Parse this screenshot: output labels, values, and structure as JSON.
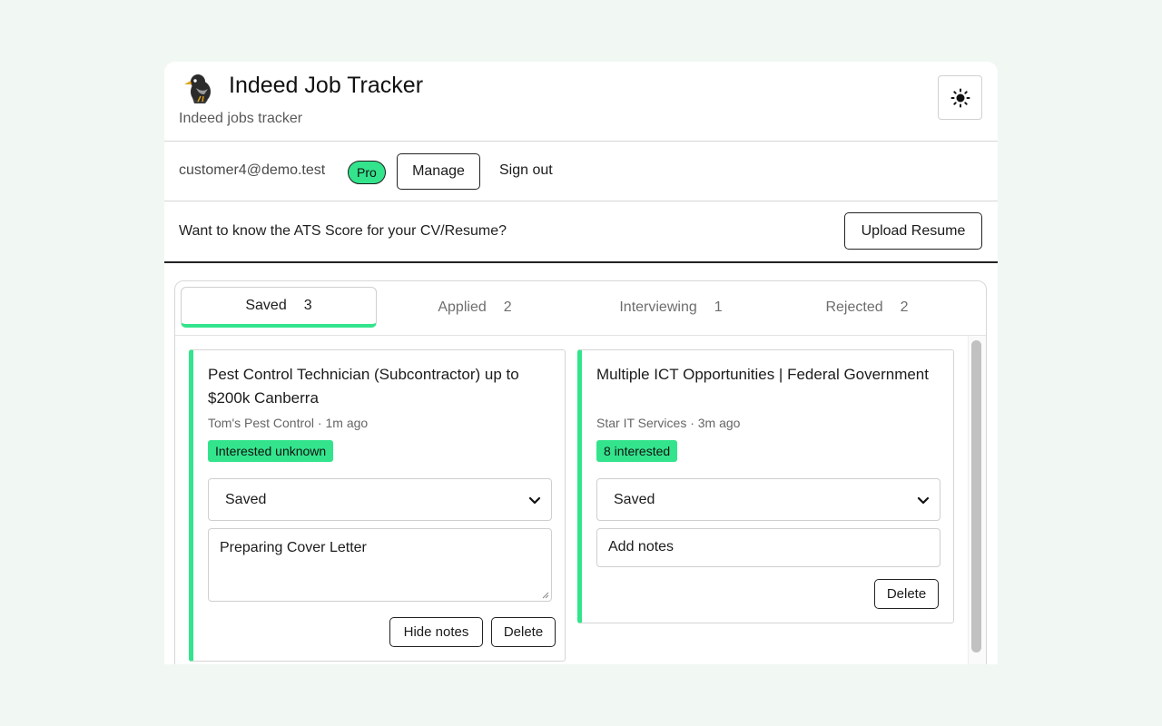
{
  "app": {
    "title": "Indeed Job Tracker",
    "subtitle": "Indeed jobs tracker",
    "logo_icon": "bird-logo-icon",
    "theme_toggle_icon": "sun-icon"
  },
  "account": {
    "email": "customer4@demo.test",
    "plan_badge": "Pro",
    "manage_label": "Manage",
    "signout_label": "Sign out"
  },
  "ats": {
    "prompt": "Want to know the ATS Score for your CV/Resume?",
    "upload_label": "Upload Resume"
  },
  "tabs": [
    {
      "label": "Saved",
      "count": "3",
      "active": true
    },
    {
      "label": "Applied",
      "count": "2",
      "active": false
    },
    {
      "label": "Interviewing",
      "count": "1",
      "active": false
    },
    {
      "label": "Rejected",
      "count": "2",
      "active": false
    }
  ],
  "cards": [
    {
      "title": "Pest Control Technician (Subcontractor) up to $200k Canberra",
      "meta": "Tom's Pest Control · 1m ago",
      "badge": "Interested unknown",
      "status": "Saved",
      "notes_value": "Preparing Cover Letter",
      "hide_notes_label": "Hide notes",
      "delete_label": "Delete"
    },
    {
      "title": "Multiple ICT Opportunities | Federal Government",
      "meta": "Star IT Services · 3m ago",
      "badge": "8 interested",
      "status": "Saved",
      "notes_placeholder": "Add notes",
      "delete_label": "Delete"
    }
  ],
  "colors": {
    "background": "#f1f8f3",
    "accent": "#33e48c",
    "text": "#1f1f1f"
  }
}
